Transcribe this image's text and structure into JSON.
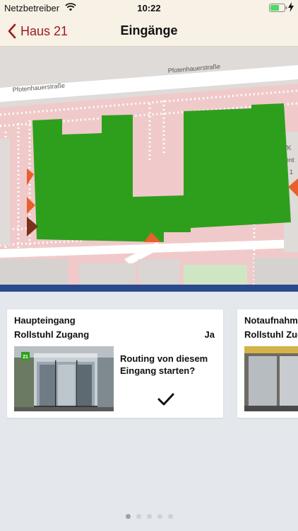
{
  "status": {
    "carrier": "Netzbetreiber",
    "time": "10:22"
  },
  "nav": {
    "back_label": "Haus 21",
    "title": "Eingänge"
  },
  "map": {
    "street_name_1": "Pfotenhauerstraße",
    "street_name_2": "Pfotenhauerstraße",
    "edge_label_1": "/K",
    "edge_label_2": "ent",
    "edge_label_3": "1",
    "building_color": "#2e9f1d",
    "entrance_marker_color": "#e8602c"
  },
  "cards": [
    {
      "title": "Haupteingang",
      "feature_label": "Rollstuhl Zugang",
      "feature_value": "Ja",
      "routing_text": "Routing von diesem Eingang starten?",
      "photo_sign": "21"
    },
    {
      "title": "Notaufnahme",
      "feature_label": "Rollstuhl Zugang"
    }
  ],
  "pagination": {
    "count": 5,
    "active_index": 0
  },
  "colors": {
    "accent": "#9c1b1b",
    "bar_background": "#f7f1e6",
    "divider": "#2b4a8c"
  }
}
